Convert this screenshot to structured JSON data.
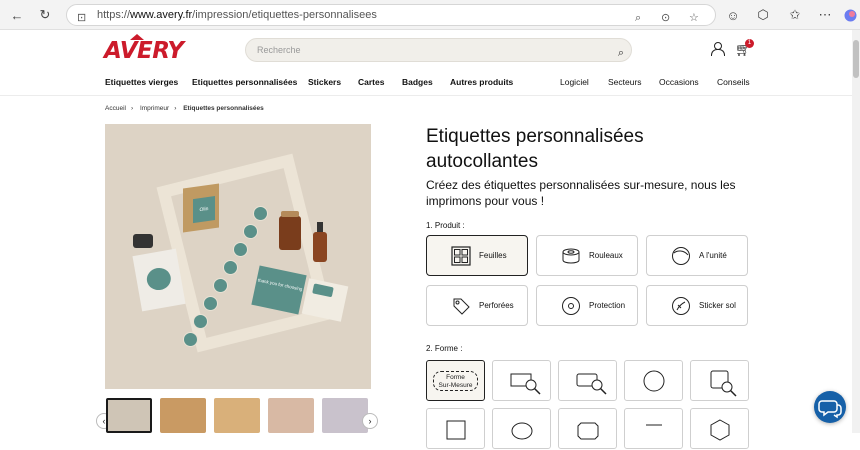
{
  "browser": {
    "url_prefix": "https://",
    "url_domain": "www.avery.fr",
    "url_path": "/impression/etiquettes-personnalisees"
  },
  "header": {
    "logo": "AVERY",
    "search_placeholder": "Recherche",
    "cart_count": "1",
    "nav_primary": [
      "Etiquettes vierges",
      "Etiquettes personnalisées",
      "Stickers",
      "Cartes",
      "Badges",
      "Autres produits"
    ],
    "nav_secondary": [
      "Logiciel",
      "Secteurs",
      "Occasions",
      "Conseils"
    ]
  },
  "breadcrumb": [
    "Accueil",
    "Imprimeur",
    "Etiquettes personnalisées"
  ],
  "gallery": {
    "bag_label": "Olin",
    "card_text": "thank you for choosing",
    "prev_icon": "chevron-left-icon",
    "next_icon": "chevron-right-icon"
  },
  "product": {
    "title_line1": "Etiquettes personnalisées",
    "title_line2": "autocollantes",
    "subtitle": "Créez des étiquettes personnalisées sur-mesure, nous les imprimons pour vous !"
  },
  "section_product": {
    "label": "1. Produit :",
    "options": [
      "Feuilles",
      "Rouleaux",
      "A l'unité",
      "Perforées",
      "Protection",
      "Sticker sol"
    ],
    "selected": "Feuilles"
  },
  "section_shape": {
    "label": "2. Forme :",
    "custom_label_line1": "Forme",
    "custom_label_line2": "Sur-Mesure"
  },
  "colors": {
    "brand_red": "#cc1b2b",
    "teal": "#5a9089",
    "chat_blue": "#1660a8"
  }
}
